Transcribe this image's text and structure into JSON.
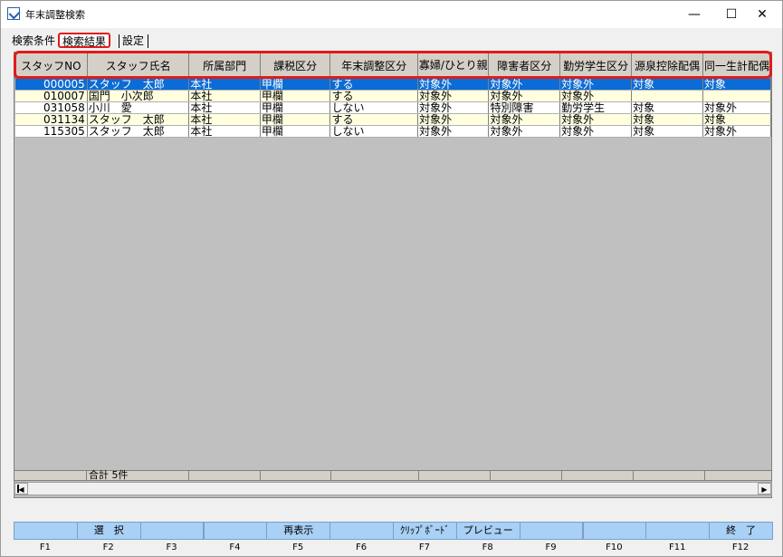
{
  "window": {
    "title": "年末調整検索",
    "minimize": "—",
    "maximize": "☐",
    "close": "✕"
  },
  "tabs": [
    {
      "label": "検索条件",
      "active": false
    },
    {
      "label": "検索結果",
      "active": true
    },
    {
      "label": "設定",
      "active": false
    }
  ],
  "grid": {
    "columns": [
      "スタッフNO",
      "スタッフ氏名",
      "所属部門",
      "課税区分",
      "年末調整区分",
      "寡婦/ひとり親",
      "障害者区分",
      "勤労学生区分",
      "源泉控除配偶",
      "同一生計配偶"
    ],
    "rows": [
      [
        "000005",
        "スタッフ　太郎",
        "本社",
        "甲欄",
        "する",
        "対象外",
        "対象外",
        "対象外",
        "対象",
        "対象"
      ],
      [
        "010007",
        "国門　小次郎",
        "本社",
        "甲欄",
        "する",
        "対象外",
        "対象外",
        "対象外",
        "",
        ""
      ],
      [
        "031058",
        "小川　愛",
        "本社",
        "甲欄",
        "しない",
        "対象外",
        "特別障害",
        "勤労学生",
        "対象",
        "対象外"
      ],
      [
        "031134",
        "スタッフ　太郎",
        "本社",
        "甲欄",
        "する",
        "対象外",
        "対象外",
        "対象外",
        "対象",
        "対象"
      ],
      [
        "115305",
        "スタッフ　太郎",
        "本社",
        "甲欄",
        "しない",
        "対象外",
        "対象外",
        "対象外",
        "対象",
        "対象外"
      ]
    ],
    "selected_row": 0,
    "total_label": "合計 5件"
  },
  "fkeys": [
    {
      "key": "F1",
      "label": ""
    },
    {
      "key": "F2",
      "label": "選　択"
    },
    {
      "key": "F3",
      "label": ""
    },
    {
      "key": "F4",
      "label": ""
    },
    {
      "key": "F5",
      "label": "再表示"
    },
    {
      "key": "F6",
      "label": ""
    },
    {
      "key": "F7",
      "label": "ｸﾘｯﾌﾟﾎﾞｰﾄﾞ"
    },
    {
      "key": "F8",
      "label": "プレビュー"
    },
    {
      "key": "F9",
      "label": ""
    },
    {
      "key": "F10",
      "label": ""
    },
    {
      "key": "F11",
      "label": ""
    },
    {
      "key": "F12",
      "label": "終　了"
    }
  ],
  "colors": {
    "header_outline": "#e01b1b",
    "selected_row": "#0a6cd6",
    "row_alt": "#ffffe0",
    "fkey_bg": "#a9d0f5"
  }
}
